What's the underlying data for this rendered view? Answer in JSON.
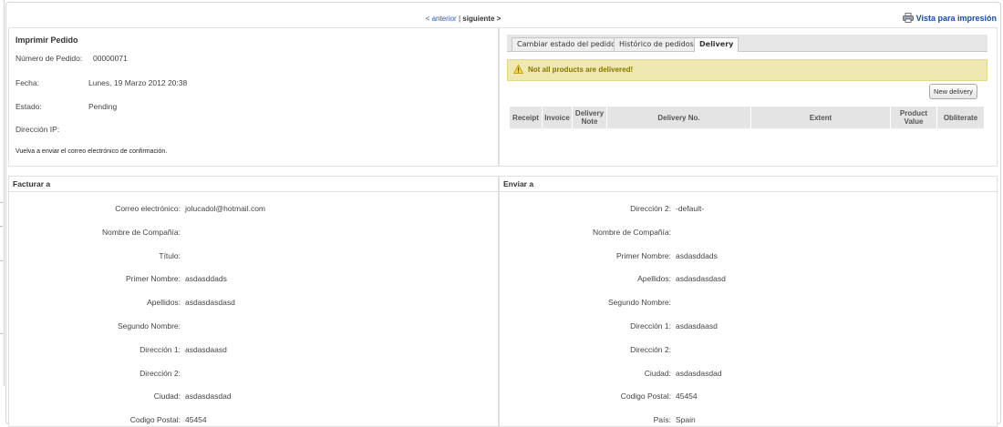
{
  "pager": {
    "prev": "< anterior",
    "sep": "|",
    "next": "siguiente >"
  },
  "print_view": "Vista para impresión",
  "order": {
    "title": "Imprimir Pedido",
    "rows": [
      {
        "label": "Número de Pedido:",
        "value": "00000071"
      },
      {
        "label": "Fecha:",
        "value": "Lunes, 19 Marzo 2012 20:38"
      },
      {
        "label": "Estado:",
        "value": "Pending"
      },
      {
        "label": "Dirección IP:",
        "value": ""
      }
    ],
    "resend": "Vuelva a enviar el correo electrónico de confirmación."
  },
  "tabs": [
    {
      "label": "Cambiar estado del pedido"
    },
    {
      "label": "Histórico de pedidos"
    },
    {
      "label": "Delivery"
    }
  ],
  "delivery": {
    "warning": "Not all products are delivered!",
    "new_button": "New delivery",
    "columns": [
      "Receipt",
      "Invoice",
      "Delivery Note",
      "Delivery No.",
      "Extent",
      "Product Value",
      "Obliterate"
    ]
  },
  "billing": {
    "title": "Facturar a",
    "fields": [
      {
        "label": "Correo electrónico:",
        "value": "jolucadol@hotmail.com"
      },
      {
        "label": "Nombre de Compañía:",
        "value": ""
      },
      {
        "label": "Título:",
        "value": ""
      },
      {
        "label": "Primer Nombre:",
        "value": "asdasddads"
      },
      {
        "label": "Apellidos:",
        "value": "asdasdasdasd"
      },
      {
        "label": "Segundo Nombre:",
        "value": ""
      },
      {
        "label": "Dirección 1:",
        "value": "asdasdaasd"
      },
      {
        "label": "Dirección 2:",
        "value": ""
      },
      {
        "label": "Ciudad:",
        "value": "asdasdasdad"
      },
      {
        "label": "Codigo Postal:",
        "value": "45454"
      }
    ]
  },
  "shipping": {
    "title": "Enviar a",
    "fields": [
      {
        "label": "Dirección 2:",
        "value": "-default-"
      },
      {
        "label": "Nombre de Compañía:",
        "value": ""
      },
      {
        "label": "Primer Nombre:",
        "value": "asdasddads"
      },
      {
        "label": "Apellidos:",
        "value": "asdasdasdasd"
      },
      {
        "label": "Segundo Nombre:",
        "value": ""
      },
      {
        "label": "Dirección 1:",
        "value": "asdasdaasd"
      },
      {
        "label": "Dirección 2:",
        "value": ""
      },
      {
        "label": "Ciudad:",
        "value": "asdasdasdad"
      },
      {
        "label": "Codigo Postal:",
        "value": "45454"
      },
      {
        "label": "País:",
        "value": "Spain"
      }
    ]
  },
  "colors": {
    "link": "#2a5fb5",
    "warning_bg": "#efe8b0",
    "warning_text": "#8a7400"
  },
  "icons": {
    "print": "printer-icon",
    "warning": "warning-icon"
  }
}
